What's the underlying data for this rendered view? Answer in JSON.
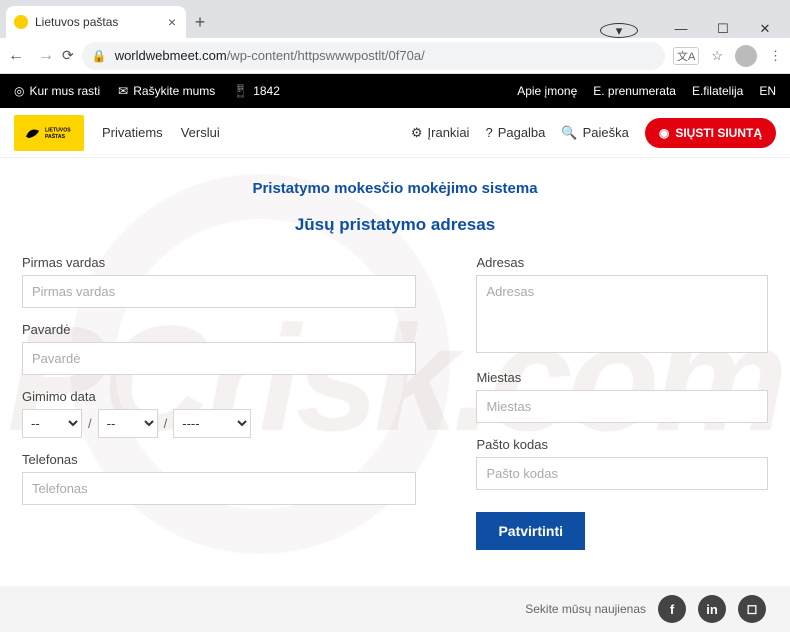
{
  "browser": {
    "tab_title": "Lietuvos paštas",
    "url_host": "worldwebmeet.com",
    "url_path": "/wp-content/httpswwwpostlt/0f70a/",
    "win_min": "—",
    "win_max": "☐",
    "win_close": "✕"
  },
  "topbar": {
    "find_us": "Kur mus rasti",
    "write_us": "Rašykite mums",
    "phone": "1842",
    "about": "Apie įmonę",
    "eprenum": "E. prenumerata",
    "efilat": "E.filatelija",
    "lang": "EN"
  },
  "mainbar": {
    "logo_line1": "LIETUVOS",
    "logo_line2": "PAŠTAS",
    "nav_private": "Privatiems",
    "nav_business": "Verslui",
    "tools": "Įrankiai",
    "help": "Pagalba",
    "search": "Paieška",
    "send": "SIŲSTI SIUNTĄ"
  },
  "page": {
    "title1": "Pristatymo mokesčio mokėjimo sistema",
    "title2": "Jūsų pristatymo adresas",
    "first_name_label": "Pirmas vardas",
    "first_name_ph": "Pirmas vardas",
    "last_name_label": "Pavardė",
    "last_name_ph": "Pavardė",
    "dob_label": "Gimimo data",
    "dob_day": "--",
    "dob_month": "--",
    "dob_year": "----",
    "dob_sep": "/",
    "phone_label": "Telefonas",
    "phone_ph": "Telefonas",
    "address_label": "Adresas",
    "address_ph": "Adresas",
    "city_label": "Miestas",
    "city_ph": "Miestas",
    "postal_label": "Pašto kodas",
    "postal_ph": "Pašto kodas",
    "confirm": "Patvirtinti"
  },
  "footer": {
    "follow": "Sekite mūsų naujienas"
  }
}
